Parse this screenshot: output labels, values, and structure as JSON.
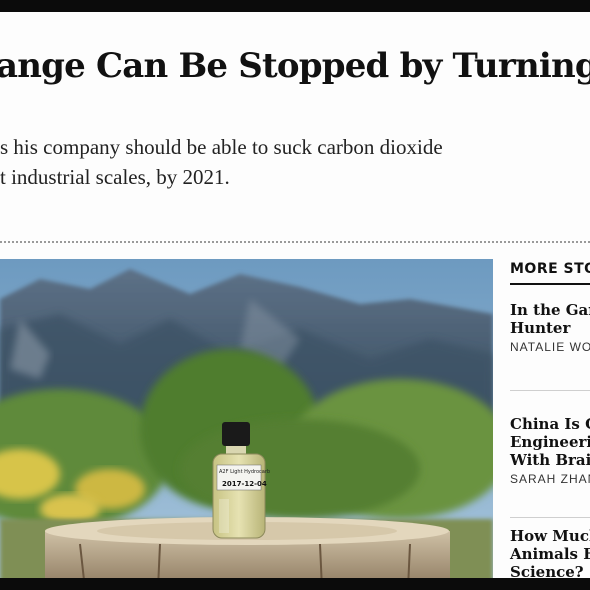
{
  "article": {
    "headline": "ange Can Be Stopped by Turning",
    "dek_line1": "s his company should be able to suck carbon dioxide",
    "dek_line2": "t industrial scales, by 2021."
  },
  "photo": {
    "bottle_label_line1": "A2F Light Hydrocarb",
    "bottle_label_line2": "2017-12-04"
  },
  "sidebar": {
    "heading": "MORE STO",
    "stories": [
      {
        "title_line1": "In the Gar",
        "title_line2": "Hunter",
        "author": "NATALIE WO"
      },
      {
        "title_line1": "China Is G",
        "title_line2": "Engineerin",
        "title_line3": "With Brain",
        "author": "SARAH ZHAN"
      },
      {
        "title_line1": "How Much",
        "title_line2": "Animals E",
        "title_line3": "Science?"
      }
    ]
  }
}
